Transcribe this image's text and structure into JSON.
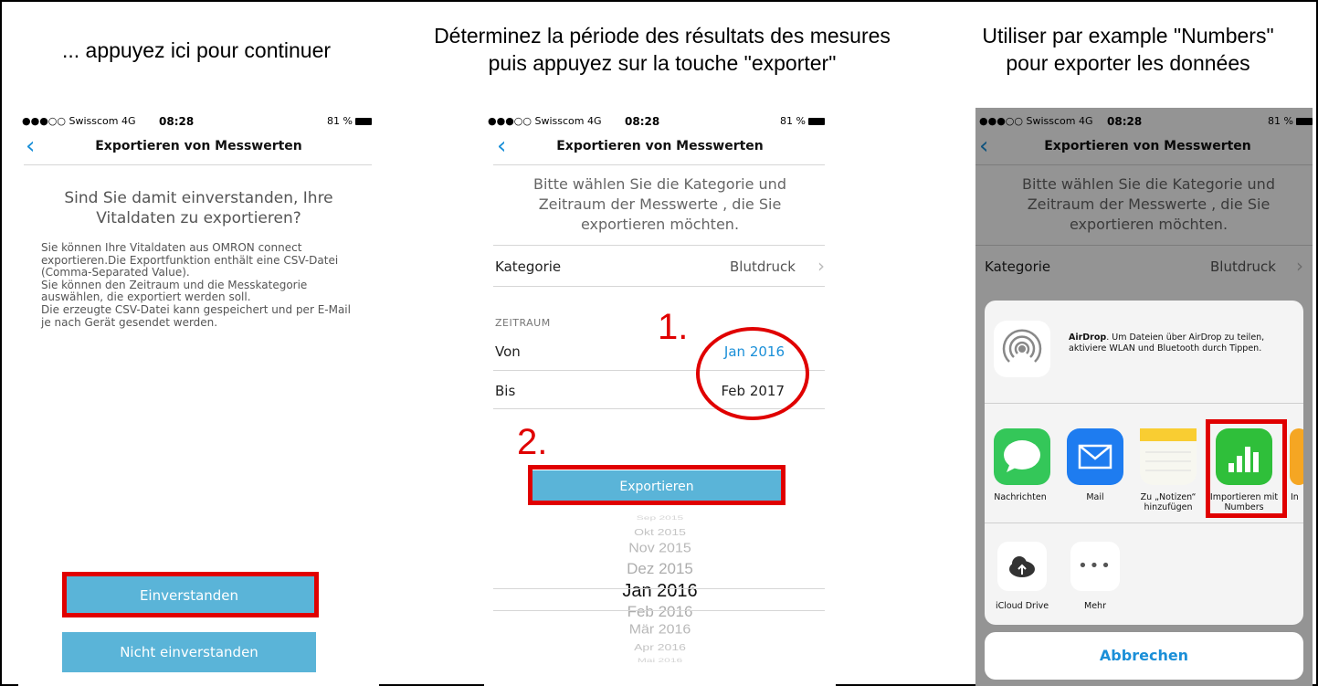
{
  "captions": {
    "left": "... appuyez ici pour continuer",
    "middle_line1": "Déterminez la période des résultats des mesures",
    "middle_line2": "puis appuyez sur la touche \"exporter\"",
    "right_line1": "Utiliser par example \"Numbers\"",
    "right_line2": "pour exporter les données"
  },
  "status_bar": {
    "carrier": "●●●○○ Swisscom  4G",
    "time": "08:28",
    "battery": "81 %"
  },
  "nav": {
    "back": "‹",
    "title": "Exportieren von Messwerten"
  },
  "screen1": {
    "question": "Sind Sie damit einverstanden, Ihre Vitaldaten zu exportieren?",
    "body": "Sie können Ihre Vitaldaten aus OMRON connect exportieren.Die Exportfunktion enthält eine CSV-Datei (Comma-Separated Value).\nSie können den Zeitraum und die Messkategorie auswählen, die exportiert werden soll.\nDie erzeugte CSV-Datei kann gespeichert und per E-Mail je nach Gerät gesendet werden.",
    "agree_button": "Einverstanden",
    "disagree_button": "Nicht einverstanden"
  },
  "screen2": {
    "prompt": "Bitte wählen Sie die Kategorie und Zeitraum der Messwerte , die Sie exportieren möchten.",
    "category_label": "Kategorie",
    "category_value": "Blutdruck",
    "section": "ZEITRAUM",
    "from_label": "Von",
    "from_value": "Jan 2016",
    "to_label": "Bis",
    "to_value": "Feb 2017",
    "export_button": "Exportieren",
    "annot_1": "1.",
    "annot_2": "2.",
    "picker": [
      "Sep 2015",
      "Okt 2015",
      "Nov 2015",
      "Dez 2015",
      "Jan 2016",
      "Feb 2016",
      "Mär 2016",
      "Apr 2016",
      "Mai 2016"
    ],
    "picker_selected_index": 4
  },
  "screen3": {
    "airdrop_title": "AirDrop",
    "airdrop_text": ". Um Dateien über AirDrop zu teilen, aktiviere WLAN und Bluetooth durch Tippen.",
    "apps": [
      {
        "label": "Nachrichten",
        "color": "#34c759"
      },
      {
        "label": "Mail",
        "color": "#1e7cf0"
      },
      {
        "label": "Zu „Notizen“ hinzufügen",
        "color": "#f7f7f0"
      },
      {
        "label": "Importieren mit Numbers",
        "color": "#2fbf3a"
      },
      {
        "label": "In",
        "color": "#f5a623"
      }
    ],
    "actions": [
      {
        "label": "iCloud Drive"
      },
      {
        "label": "Mehr"
      }
    ],
    "cancel_button": "Abbrechen"
  },
  "colors": {
    "accent": "#1a8fd8",
    "button": "#5ab4d8",
    "highlight": "#e00000"
  }
}
